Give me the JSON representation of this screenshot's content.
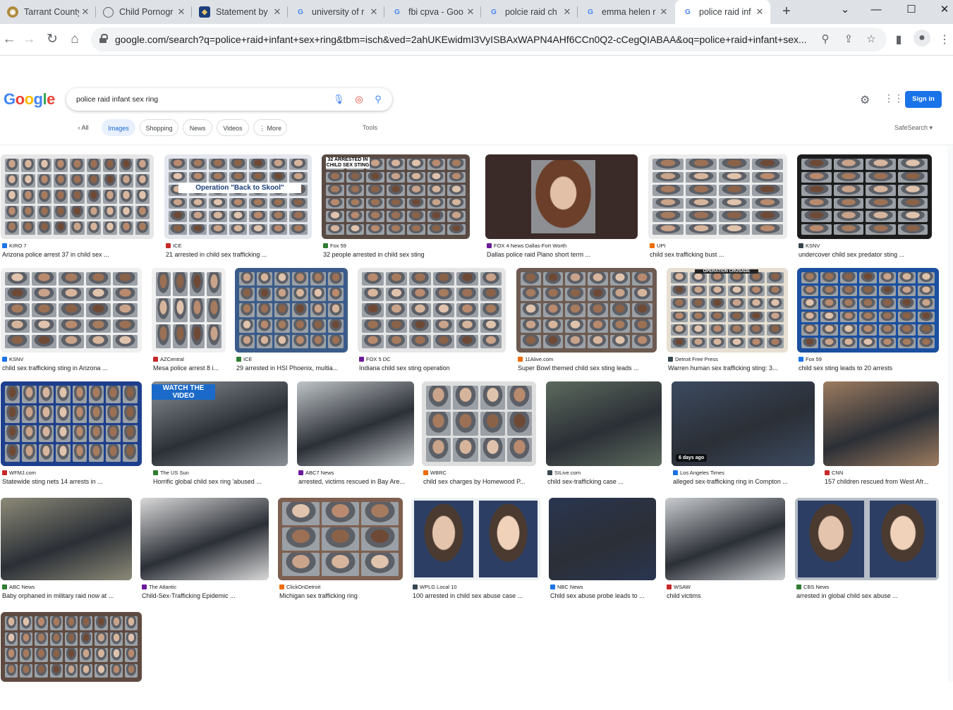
{
  "browser": {
    "tabs": [
      {
        "title": "Tarrant County",
        "fav": "seal",
        "favColor": "#b08a3e"
      },
      {
        "title": "Child Pornogr",
        "fav": "globe",
        "favColor": "#5f6368"
      },
      {
        "title": "Statement by",
        "fav": "shield",
        "favColor": "#1c3f7a"
      },
      {
        "title": "university of r",
        "fav": "G",
        "favColor": "#4285f4"
      },
      {
        "title": "fbi cpva - Goo",
        "fav": "G",
        "favColor": "#4285f4"
      },
      {
        "title": "polcie raid ch",
        "fav": "G",
        "favColor": "#4285f4"
      },
      {
        "title": "emma helen r",
        "fav": "G",
        "favColor": "#4285f4"
      },
      {
        "title": "police raid inf",
        "fav": "G",
        "favColor": "#4285f4"
      }
    ],
    "url": "google.com/search?q=police+raid+infant+sex+ring&tbm=isch&ved=2ahUKEwidmI3VyISBAxWAPN4AHf6CCn0Q2-cCegQIABAA&oq=police+raid+infant+sex..."
  },
  "google": {
    "logo": "Google",
    "query": "police raid infant sex ring",
    "sign_in": "Sign in",
    "chips": [
      "All",
      "Images",
      "Shopping",
      "News",
      "Videos",
      "More"
    ],
    "tools": "Tools",
    "safesearch": "SafeSearch"
  },
  "results": [
    {
      "source": "KIRO 7",
      "caption": "Arizona police arrest 37 in child sex ..."
    },
    {
      "source": "ICE",
      "caption": "21 arrested in child sex trafficking ...",
      "overlay": "Operation \"Back to Skool\""
    },
    {
      "source": "Fox 59",
      "caption": "32 people arrested in child sex sting",
      "overlay": "32 ARRESTED IN CHILD SEX STING"
    },
    {
      "source": "FOX 4 News Dallas-Fort Worth",
      "caption": "Dallas police raid Plano short term ..."
    },
    {
      "source": "UPI",
      "caption": "child sex trafficking bust ..."
    },
    {
      "source": "KSNV",
      "caption": "undercover child sex predator sting ..."
    },
    {
      "source": "KSNV",
      "caption": "child sex trafficking sting in Arizona ..."
    },
    {
      "source": "AZCentral",
      "caption": "Mesa police arrest 8 i..."
    },
    {
      "source": "ICE",
      "caption": "29 arrested in HSI Phoenix, multia..."
    },
    {
      "source": "FOX 5 DC",
      "caption": "Indiana child sex sting operation"
    },
    {
      "source": "11Alive.com",
      "caption": "Super Bowl themed child sex sting leads ..."
    },
    {
      "source": "Detroit Free Press",
      "caption": "Warren human sex trafficking sting: 3...",
      "overlay": "OPERATION CRUSADE"
    },
    {
      "source": "Fox 59",
      "caption": "child sex sting leads to 20 arrests"
    },
    {
      "source": "WFMJ.com",
      "caption": "Statewide sting nets 14 arrests in ..."
    },
    {
      "source": "The US Sun",
      "caption": "Horrific global child sex ring 'abused ...",
      "overlay": "WATCH THE VIDEO"
    },
    {
      "source": "ABC7 News",
      "caption": "arrested, victims rescued in Bay Are..."
    },
    {
      "source": "WBRC",
      "caption": "child sex charges by Homewood P..."
    },
    {
      "source": "SILive.com",
      "caption": "child sex-trafficking case ..."
    },
    {
      "source": "Los Angeles Times",
      "caption": "alleged sex-trafficking ring in Compton ...",
      "badge": "6 days ago"
    },
    {
      "source": "CNN",
      "caption": "157 children rescued from West Afr..."
    },
    {
      "source": "ABC News",
      "caption": "Baby orphaned in military raid now at ..."
    },
    {
      "source": "The Atlantic",
      "caption": "Child-Sex-Trafficking Epidemic ..."
    },
    {
      "source": "ClickOnDetroit",
      "caption": "Michigan sex trafficking ring"
    },
    {
      "source": "WPLG Local 10",
      "caption": "100 arrested in child sex abuse case ..."
    },
    {
      "source": "NBC News",
      "caption": "Child sex abuse probe leads to ..."
    },
    {
      "source": "WSAW",
      "caption": "child victims"
    },
    {
      "source": "CBS News",
      "caption": "arrested in global child sex abuse ..."
    },
    {
      "source": "",
      "caption": ""
    }
  ],
  "colors": {
    "accent": "#1a73e8",
    "chip_selected": "#e8f0fe"
  }
}
